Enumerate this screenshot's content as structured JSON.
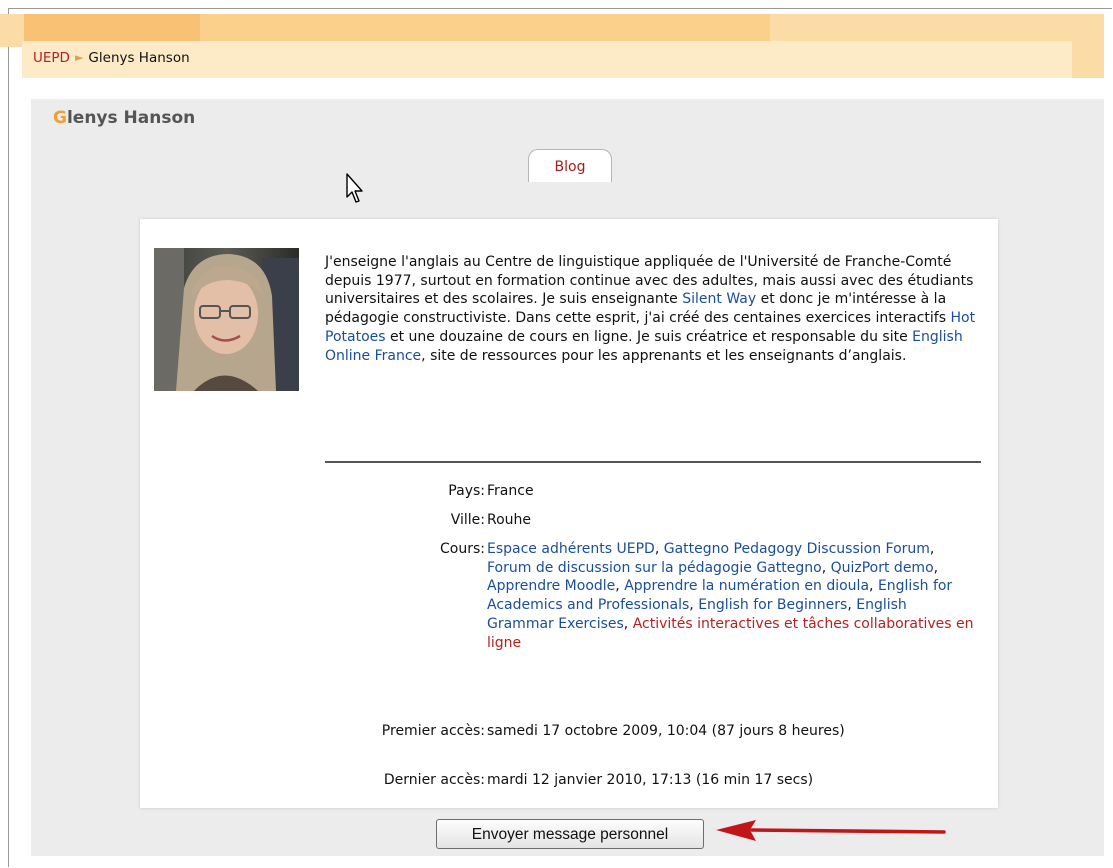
{
  "breadcrumb": {
    "home": "UEPD",
    "separator": "►",
    "current": "Glenys Hanson"
  },
  "profile": {
    "name_first_letter": "G",
    "name_rest": "lenys Hanson",
    "tabs": [
      {
        "label": "Blog",
        "active": true
      }
    ],
    "bio": {
      "part1": "J'enseigne l'anglais au Centre de linguistique appliquée de l'Université de Franche-Comté depuis 1977, surtout en formation continue avec des adultes, mais aussi avec des étudiants universitaires et des scolaires. Je suis enseignante ",
      "link1": "Silent Way",
      "part2": " et donc je m'intéresse à la pédagogie constructiviste. Dans cette esprit, j'ai créé des centaines exercices interactifs ",
      "link2": "Hot Potatoes",
      "part3": " et une douzaine de cours en ligne. Je suis créatrice et responsable du site ",
      "link3": "English Online France",
      "part4": ", site de ressources pour les apprenants et les enseignants d’anglais."
    },
    "fields": {
      "pays": {
        "label": "Pays:",
        "value": "France"
      },
      "ville": {
        "label": "Ville:",
        "value": "Rouhe"
      },
      "cours": {
        "label": "Cours:",
        "items": [
          "Espace adhérents UEPD",
          "Gattegno Pedagogy Discussion Forum",
          "Forum de discussion sur la pédagogie Gattegno",
          "QuizPort demo",
          "Apprendre Moodle",
          "Apprendre la numération en dioula",
          "English for Academics and Professionals",
          "English for Beginners",
          "English Grammar Exercises",
          "Activités interactives et tâches collaboratives en ligne"
        ],
        "separator": ", "
      },
      "premier_acces": {
        "label": "Premier accès:",
        "value": "samedi 17 octobre 2009, 10:04  (87 jours 8 heures)"
      },
      "dernier_acces": {
        "label": "Dernier accès:",
        "value": "mardi 12 janvier 2010, 17:13  (16 min 17 secs)"
      }
    },
    "send_message_button": "Envoyer message personnel"
  },
  "colors": {
    "accent_orange": "#f0a030",
    "link_blue": "#1a4e9a",
    "link_visited_red": "#b22222",
    "panel_grey": "#ececec",
    "arrow_red": "#c0161a"
  },
  "icons": {
    "cursor": "mouse-pointer-icon",
    "arrow": "red-arrow-annotation-icon",
    "breadcrumb_separator": "triangle-right-icon"
  }
}
